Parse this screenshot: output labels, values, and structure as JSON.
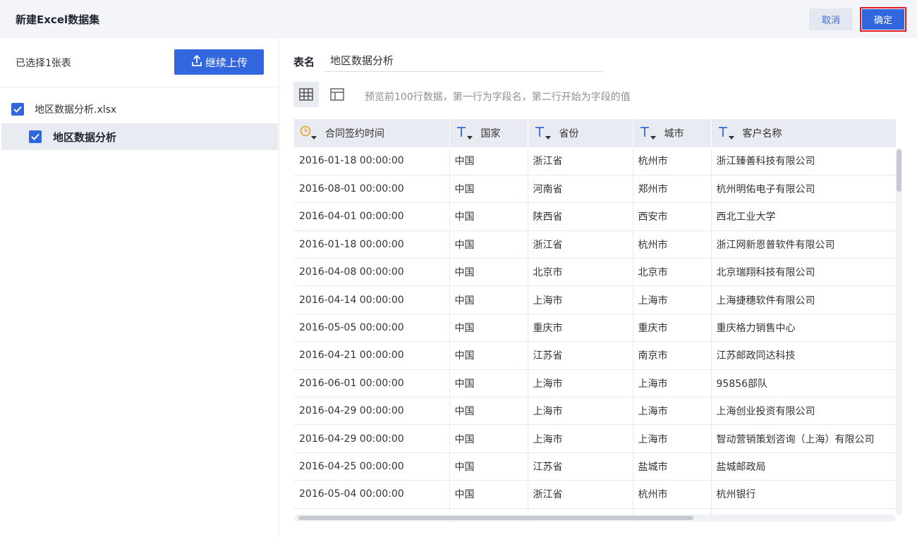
{
  "header": {
    "title": "新建Excel数据集",
    "cancel_label": "取消",
    "confirm_label": "确定"
  },
  "sidebar": {
    "selected_count": "已选择1张表",
    "upload_label": "继续上传",
    "file": {
      "label": "地区数据分析.xlsx",
      "checked": true
    },
    "sheet": {
      "label": "地区数据分析",
      "checked": true
    }
  },
  "main": {
    "table_name_label": "表名",
    "table_name_value": "地区数据分析",
    "preview_hint": "预览前100行数据，第一行为字段名，第二行开始为字段的值"
  },
  "table": {
    "columns": [
      {
        "label": "合同签约时间",
        "type_icon": "clock-icon",
        "type_color": "#f0a020"
      },
      {
        "label": "国家",
        "type_icon": "text-type-icon",
        "type_color": "#3266df"
      },
      {
        "label": "省份",
        "type_icon": "text-type-icon",
        "type_color": "#3266df"
      },
      {
        "label": "城市",
        "type_icon": "text-type-icon",
        "type_color": "#3266df"
      },
      {
        "label": "客户名称",
        "type_icon": "text-type-icon",
        "type_color": "#3266df"
      }
    ],
    "rows": [
      [
        "2016-01-18 00:00:00",
        "中国",
        "浙江省",
        "杭州市",
        "浙江臻善科技有限公司"
      ],
      [
        "2016-08-01 00:00:00",
        "中国",
        "河南省",
        "郑州市",
        "杭州明佑电子有限公司"
      ],
      [
        "2016-04-01 00:00:00",
        "中国",
        "陕西省",
        "西安市",
        "西北工业大学"
      ],
      [
        "2016-01-18 00:00:00",
        "中国",
        "浙江省",
        "杭州市",
        "浙江网新恩普软件有限公司"
      ],
      [
        "2016-04-08 00:00:00",
        "中国",
        "北京市",
        "北京市",
        "北京瑞翔科技有限公司"
      ],
      [
        "2016-04-14 00:00:00",
        "中国",
        "上海市",
        "上海市",
        "上海捷穗软件有限公司"
      ],
      [
        "2016-05-05 00:00:00",
        "中国",
        "重庆市",
        "重庆市",
        "重庆格力销售中心"
      ],
      [
        "2016-04-21 00:00:00",
        "中国",
        "江苏省",
        "南京市",
        "江苏邮政同达科技"
      ],
      [
        "2016-06-01 00:00:00",
        "中国",
        "上海市",
        "上海市",
        "95856部队"
      ],
      [
        "2016-04-29 00:00:00",
        "中国",
        "上海市",
        "上海市",
        "上海创业投资有限公司"
      ],
      [
        "2016-04-29 00:00:00",
        "中国",
        "上海市",
        "上海市",
        "智动营销策划咨询（上海）有限公司"
      ],
      [
        "2016-04-25 00:00:00",
        "中国",
        "江苏省",
        "盐城市",
        "盐城邮政局"
      ],
      [
        "2016-05-04 00:00:00",
        "中国",
        "浙江省",
        "杭州市",
        "杭州银行"
      ],
      [
        "",
        "",
        "",
        "",
        ""
      ]
    ]
  },
  "colors": {
    "primary": "#3266df",
    "highlight_border": "#e31b23",
    "header_bg": "#f3f5f9",
    "table_header_bg": "#e8ebf1"
  }
}
